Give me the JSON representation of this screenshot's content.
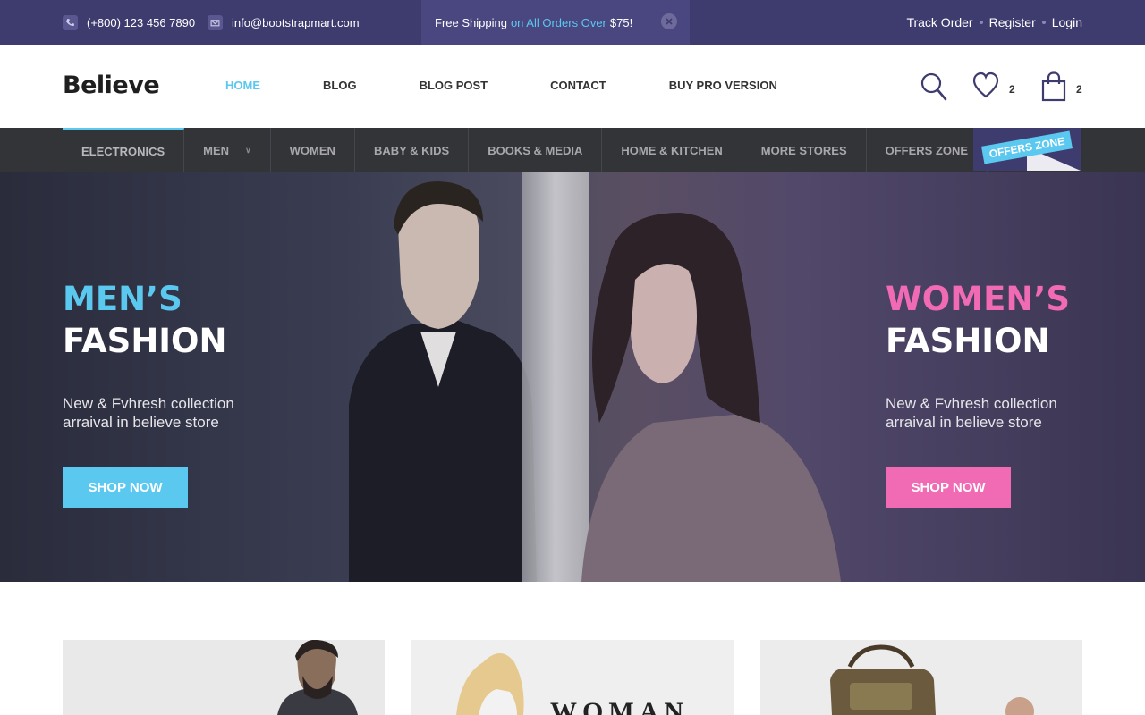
{
  "topbar": {
    "phone": "(+800) 123 456 7890",
    "email": "info@bootstrapmart.com",
    "promo_prefix": "Free Shipping",
    "promo_highlight": "on All Orders Over",
    "promo_value": "$75!",
    "links": [
      "Track Order",
      "Register",
      "Login"
    ]
  },
  "header": {
    "logo": "Believe",
    "nav": [
      "HOME",
      "BLOG",
      "BLOG POST",
      "CONTACT",
      "BUY PRO VERSION"
    ],
    "wishlist_count": "2",
    "cart_count": "2"
  },
  "categories": [
    "ELECTRONICS",
    "MEN",
    "WOMEN",
    "BABY & KIDS",
    "BOOKS & MEDIA",
    "HOME & KITCHEN",
    "MORE STORES",
    "OFFERS ZONE"
  ],
  "offers_badge": "OFFERS ZONE",
  "hero": {
    "men": {
      "title1": "MEN’S",
      "title2": "FASHION",
      "subtitle": "New & Fvhresh collection arraival in believe store",
      "button": "SHOP NOW"
    },
    "women": {
      "title1": "WOMEN’S",
      "title2": "FASHION",
      "subtitle": "New & Fvhresh collection arraival in believe store",
      "button": "SHOP NOW"
    }
  },
  "colors": {
    "topbar": "#3e3b6e",
    "accent_blue": "#5bc8f0",
    "accent_pink": "#f06ab4",
    "catbar": "#333438"
  },
  "icons": [
    "phone-icon",
    "mail-icon",
    "close-icon",
    "search-icon",
    "heart-icon",
    "bag-icon",
    "chevron-down-icon"
  ]
}
